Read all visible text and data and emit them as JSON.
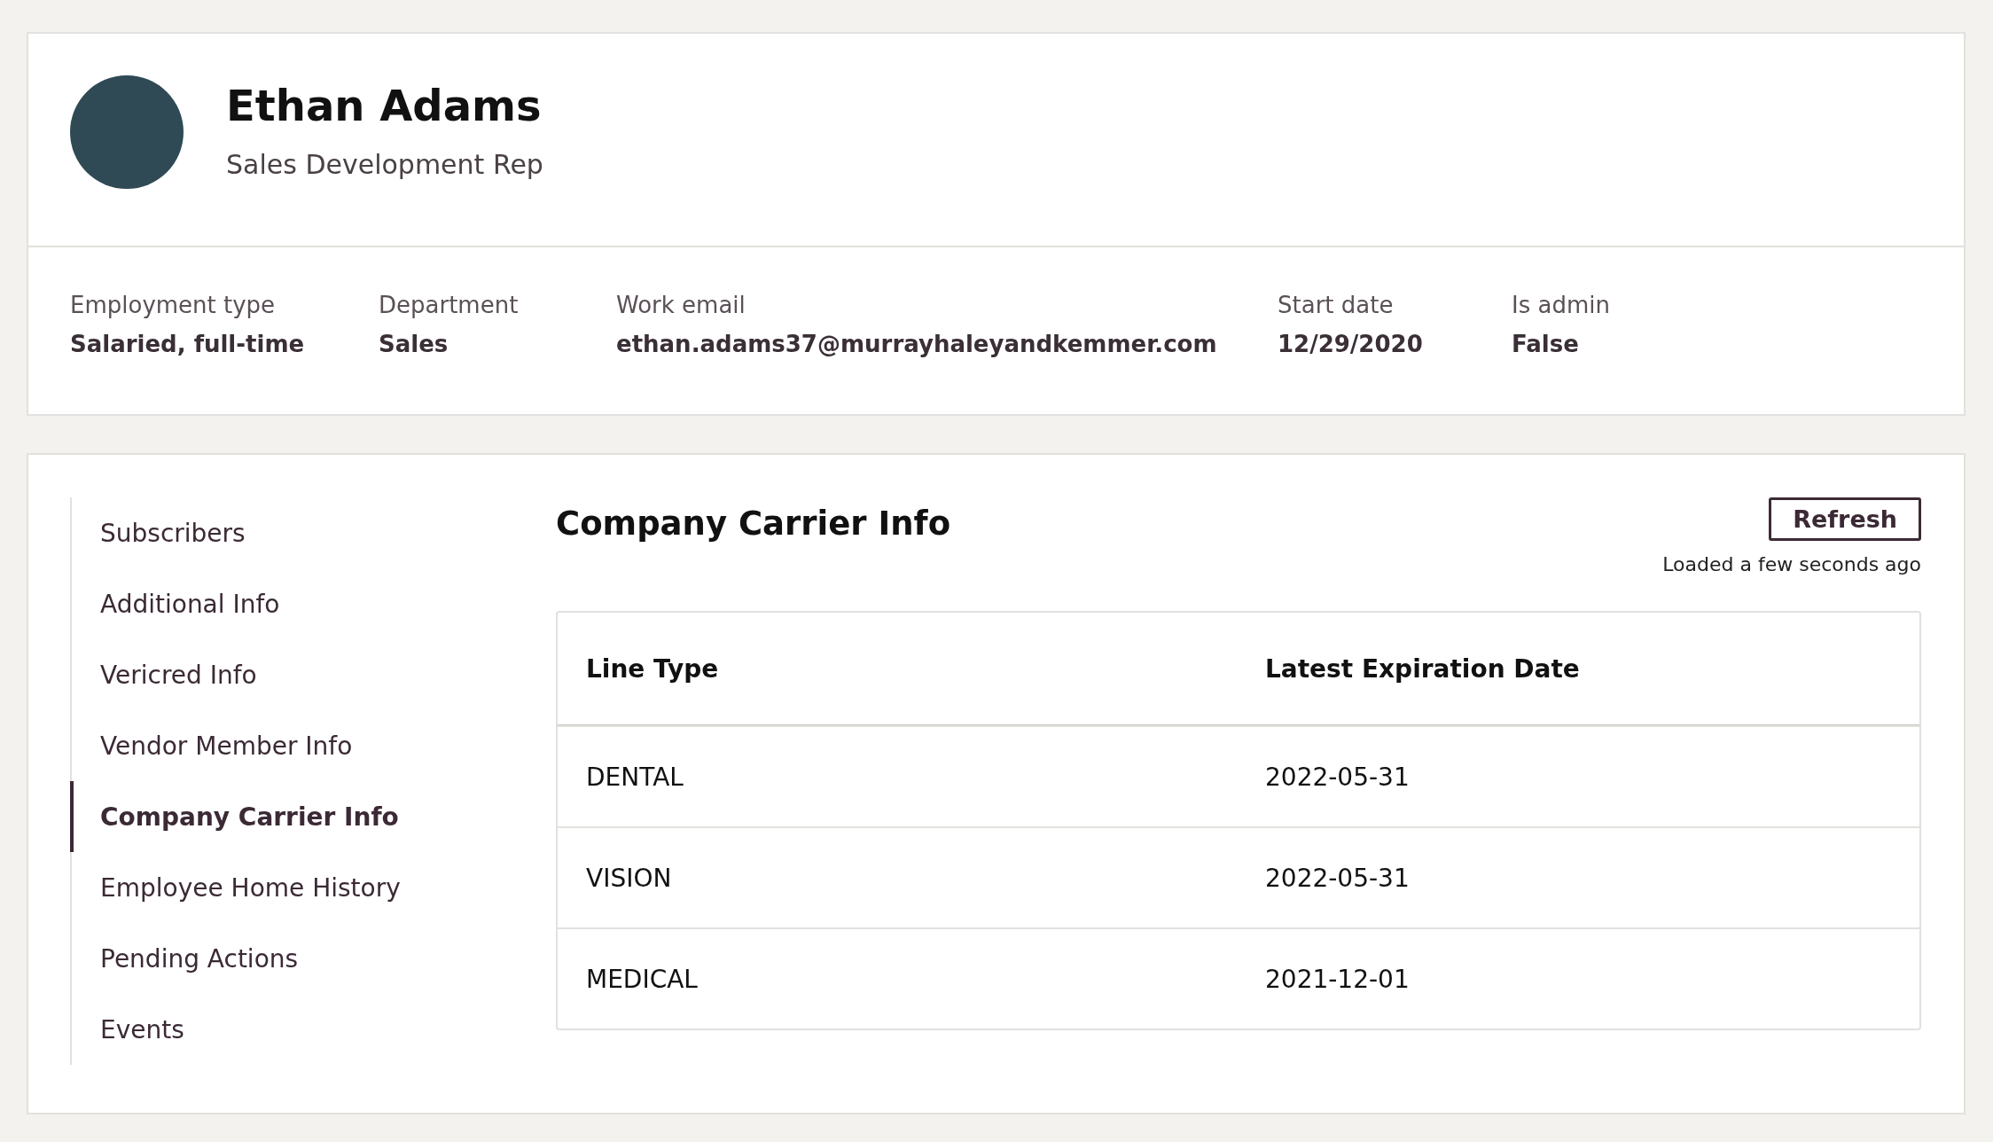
{
  "profile": {
    "name": "Ethan Adams",
    "title": "Sales Development Rep"
  },
  "details": [
    {
      "label": "Employment type",
      "value": "Salaried, full-time"
    },
    {
      "label": "Department",
      "value": "Sales"
    },
    {
      "label": "Work email",
      "value": "ethan.adams37@murrayhaleyandkemmer.com"
    },
    {
      "label": "Start date",
      "value": "12/29/2020"
    },
    {
      "label": "Is admin",
      "value": "False"
    }
  ],
  "sidebar": {
    "items": [
      {
        "label": "Subscribers",
        "selected": false
      },
      {
        "label": "Additional Info",
        "selected": false
      },
      {
        "label": "Vericred Info",
        "selected": false
      },
      {
        "label": "Vendor Member Info",
        "selected": false
      },
      {
        "label": "Company Carrier Info",
        "selected": true
      },
      {
        "label": "Employee Home History",
        "selected": false
      },
      {
        "label": "Pending Actions",
        "selected": false
      },
      {
        "label": "Events",
        "selected": false
      }
    ]
  },
  "section": {
    "title": "Company Carrier Info",
    "refresh_button": "Refresh",
    "loaded_status": "Loaded a few seconds ago"
  },
  "table": {
    "columns": [
      "Line Type",
      "Latest Expiration Date"
    ],
    "rows": [
      [
        "DENTAL",
        "2022-05-31"
      ],
      [
        "VISION",
        "2022-05-31"
      ],
      [
        "MEDICAL",
        "2021-12-01"
      ]
    ]
  }
}
